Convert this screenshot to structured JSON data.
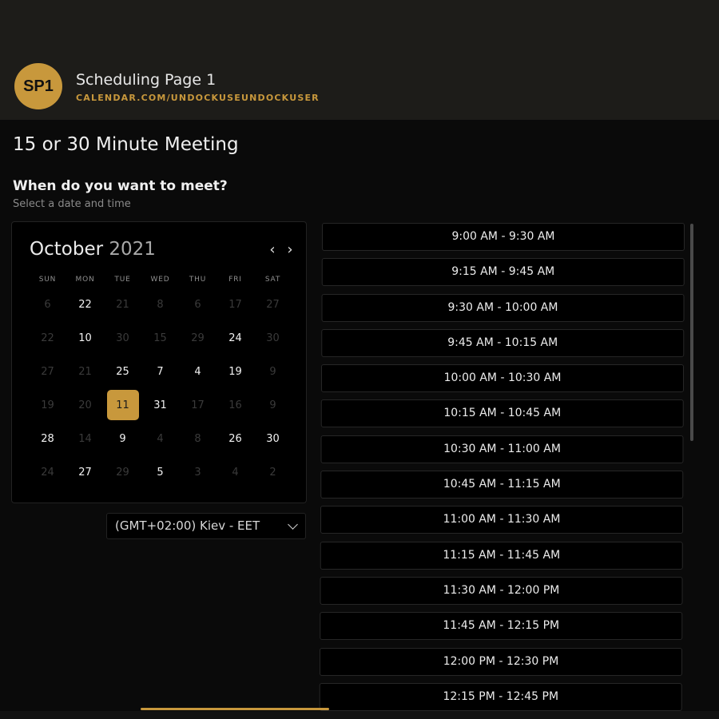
{
  "header": {
    "avatar_text": "SP1",
    "page_name": "Scheduling Page 1",
    "page_url": "CALENDAR.COM/UNDOCKUSEUNDOCKUSER"
  },
  "meeting": {
    "title": "15 or 30 Minute Meeting",
    "question": "When do you want to meet?",
    "subtitle": "Select a date and time"
  },
  "calendar": {
    "month": "October",
    "year": "2021",
    "prev_icon": "‹",
    "next_icon": "›",
    "weekdays": [
      "SUN",
      "MON",
      "TUE",
      "WED",
      "THU",
      "FRI",
      "SAT"
    ],
    "weeks": [
      [
        {
          "d": "6",
          "a": false
        },
        {
          "d": "22",
          "a": true
        },
        {
          "d": "21",
          "a": false
        },
        {
          "d": "8",
          "a": false
        },
        {
          "d": "6",
          "a": false
        },
        {
          "d": "17",
          "a": false
        },
        {
          "d": "27",
          "a": false
        }
      ],
      [
        {
          "d": "22",
          "a": false
        },
        {
          "d": "10",
          "a": true
        },
        {
          "d": "30",
          "a": false
        },
        {
          "d": "15",
          "a": false
        },
        {
          "d": "29",
          "a": false
        },
        {
          "d": "24",
          "a": true
        },
        {
          "d": "30",
          "a": false
        }
      ],
      [
        {
          "d": "27",
          "a": false
        },
        {
          "d": "21",
          "a": false
        },
        {
          "d": "25",
          "a": true
        },
        {
          "d": "7",
          "a": true
        },
        {
          "d": "4",
          "a": true
        },
        {
          "d": "19",
          "a": true
        },
        {
          "d": "9",
          "a": false
        }
      ],
      [
        {
          "d": "19",
          "a": false
        },
        {
          "d": "20",
          "a": false
        },
        {
          "d": "11",
          "a": true,
          "sel": true
        },
        {
          "d": "31",
          "a": true
        },
        {
          "d": "17",
          "a": false
        },
        {
          "d": "16",
          "a": false
        },
        {
          "d": "9",
          "a": false
        }
      ],
      [
        {
          "d": "28",
          "a": true
        },
        {
          "d": "14",
          "a": false
        },
        {
          "d": "9",
          "a": true
        },
        {
          "d": "4",
          "a": false
        },
        {
          "d": "8",
          "a": false
        },
        {
          "d": "26",
          "a": true
        },
        {
          "d": "30",
          "a": true
        }
      ],
      [
        {
          "d": "24",
          "a": false
        },
        {
          "d": "27",
          "a": true
        },
        {
          "d": "29",
          "a": false
        },
        {
          "d": "5",
          "a": true
        },
        {
          "d": "3",
          "a": false
        },
        {
          "d": "4",
          "a": false
        },
        {
          "d": "2",
          "a": false
        }
      ]
    ],
    "colors": {
      "accent": "#c8983c",
      "muted_day": "#3a3a3a",
      "available_day": "#f2f2f2"
    }
  },
  "timezone": {
    "value": "(GMT+02:00) Kiev - EET"
  },
  "slots": [
    "9:00 AM - 9:30 AM",
    "9:15 AM - 9:45 AM",
    "9:30 AM - 10:00 AM",
    "9:45 AM - 10:15 AM",
    "10:00 AM - 10:30 AM",
    "10:15 AM - 10:45 AM",
    "10:30 AM - 11:00 AM",
    "10:45 AM - 11:15 AM",
    "11:00 AM - 11:30 AM",
    "11:15 AM - 11:45 AM",
    "11:30 AM - 12:00 PM",
    "11:45 AM - 12:15 PM",
    "12:00 PM - 12:30 PM",
    "12:15 PM - 12:45 PM"
  ]
}
